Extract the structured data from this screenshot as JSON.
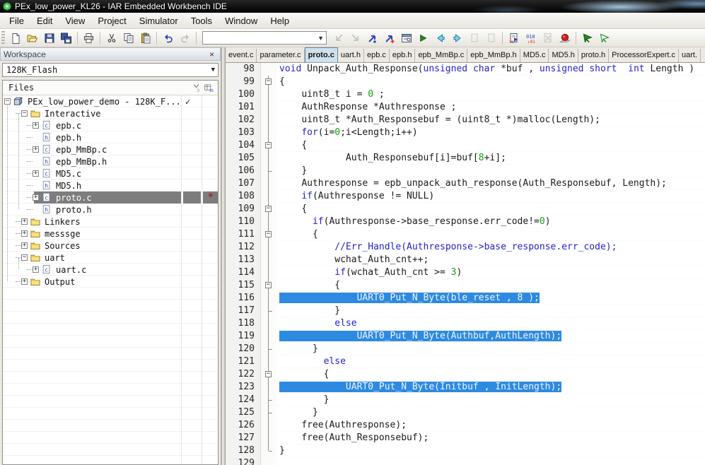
{
  "window": {
    "title": "PEx_low_power_KL26 - IAR Embedded Workbench IDE"
  },
  "menu": {
    "items": [
      "File",
      "Edit",
      "View",
      "Project",
      "Simulator",
      "Tools",
      "Window",
      "Help"
    ]
  },
  "toolbar": {
    "combo_value": "",
    "items": [
      {
        "t": "icon",
        "n": "new-file"
      },
      {
        "t": "icon",
        "n": "open-file"
      },
      {
        "t": "icon",
        "n": "save-file"
      },
      {
        "t": "icon",
        "n": "save-all"
      },
      {
        "t": "sep"
      },
      {
        "t": "icon",
        "n": "print"
      },
      {
        "t": "sep"
      },
      {
        "t": "icon",
        "n": "cut"
      },
      {
        "t": "icon",
        "n": "copy"
      },
      {
        "t": "icon",
        "n": "paste"
      },
      {
        "t": "sep"
      },
      {
        "t": "icon",
        "n": "undo"
      },
      {
        "t": "icon",
        "n": "redo",
        "d": 1
      },
      {
        "t": "sep"
      },
      {
        "t": "combo"
      },
      {
        "t": "icon",
        "n": "find-previous",
        "d": 1
      },
      {
        "t": "icon",
        "n": "find-next",
        "d": 1
      },
      {
        "t": "icon",
        "n": "toggle-bookmark"
      },
      {
        "t": "icon",
        "n": "add-bookmark"
      },
      {
        "t": "icon",
        "n": "find-in-files"
      },
      {
        "t": "icon",
        "n": "go"
      },
      {
        "t": "icon",
        "n": "navigate-back"
      },
      {
        "t": "icon",
        "n": "navigate-forward"
      },
      {
        "t": "icon",
        "n": "previous-bookmark",
        "d": 1
      },
      {
        "t": "icon",
        "n": "next-bookmark",
        "d": 1
      },
      {
        "t": "sep"
      },
      {
        "t": "icon",
        "n": "make"
      },
      {
        "t": "icon",
        "n": "compile"
      },
      {
        "t": "icon",
        "n": "stop-build",
        "d": 1
      },
      {
        "t": "icon",
        "n": "toggle-breakpoint"
      },
      {
        "t": "sep"
      },
      {
        "t": "icon",
        "n": "download-and-debug"
      },
      {
        "t": "icon",
        "n": "debug-without-downloading"
      }
    ]
  },
  "workspace": {
    "title": "Workspace",
    "close_glyph": "×",
    "config_select": "128K_Flash",
    "files_header": "Files",
    "check_glyph": "✓",
    "modified_glyph": "*",
    "tree": [
      {
        "label": "PEx_low_power_demo - 128K_F...",
        "level": 0,
        "exp": "minus",
        "icon": "project",
        "check": true
      },
      {
        "label": "Interactive",
        "level": 1,
        "exp": "minus",
        "icon": "folder"
      },
      {
        "label": "epb.c",
        "level": 2,
        "exp": "plus",
        "icon": "cfile"
      },
      {
        "label": "epb.h",
        "level": 2,
        "exp": "none",
        "icon": "hfile"
      },
      {
        "label": "epb_MmBp.c",
        "level": 2,
        "exp": "plus",
        "icon": "cfile"
      },
      {
        "label": "epb_MmBp.h",
        "level": 2,
        "exp": "none",
        "icon": "hfile"
      },
      {
        "label": "MD5.c",
        "level": 2,
        "exp": "plus",
        "icon": "cfile"
      },
      {
        "label": "MD5.h",
        "level": 2,
        "exp": "none",
        "icon": "hfile"
      },
      {
        "label": "proto.c",
        "level": 2,
        "exp": "plus",
        "icon": "cfile",
        "selected": true,
        "marker": true
      },
      {
        "label": "proto.h",
        "level": 2,
        "exp": "none",
        "icon": "hfile"
      },
      {
        "label": "Linkers",
        "level": 1,
        "exp": "plus",
        "icon": "folder"
      },
      {
        "label": "messsge",
        "level": 1,
        "exp": "plus",
        "icon": "folder"
      },
      {
        "label": "Sources",
        "level": 1,
        "exp": "plus",
        "icon": "folder"
      },
      {
        "label": "uart",
        "level": 1,
        "exp": "minus",
        "icon": "folder"
      },
      {
        "label": "uart.c",
        "level": 2,
        "exp": "plus",
        "icon": "cfile"
      },
      {
        "label": "Output",
        "level": 1,
        "exp": "plus",
        "icon": "folder"
      }
    ]
  },
  "editor": {
    "tabs": [
      {
        "label": "event.c"
      },
      {
        "label": "parameter.c"
      },
      {
        "label": "proto.c",
        "active": true
      },
      {
        "label": "uart.h"
      },
      {
        "label": "epb.c"
      },
      {
        "label": "epb.h"
      },
      {
        "label": "epb_MmBp.c"
      },
      {
        "label": "epb_MmBp.h"
      },
      {
        "label": "MD5.c"
      },
      {
        "label": "MD5.h"
      },
      {
        "label": "proto.h"
      },
      {
        "label": "ProcessorExpert.c"
      },
      {
        "label": "uart."
      }
    ],
    "lines": [
      {
        "num": 98,
        "fold": "none",
        "ind": 0,
        "segs": [
          [
            "void",
            "k"
          ],
          [
            " Unpack_Auth_Response(",
            "p"
          ],
          [
            "unsigned",
            "k"
          ],
          [
            " ",
            "p"
          ],
          [
            "char",
            "k"
          ],
          [
            " *buf , ",
            "p"
          ],
          [
            "unsigned",
            "k"
          ],
          [
            " ",
            "p"
          ],
          [
            "short",
            "k"
          ],
          [
            "  ",
            "p"
          ],
          [
            "int",
            "k"
          ],
          [
            " Length )",
            "p"
          ]
        ]
      },
      {
        "num": 99,
        "fold": "box",
        "ind": 0,
        "segs": [
          [
            "{",
            "p"
          ]
        ]
      },
      {
        "num": 100,
        "fold": "line",
        "ind": 4,
        "segs": [
          [
            "uint8_t i = ",
            "p"
          ],
          [
            "0",
            "n"
          ],
          [
            " ;",
            "p"
          ]
        ]
      },
      {
        "num": 101,
        "fold": "line",
        "ind": 4,
        "segs": [
          [
            "AuthResponse *Authresponse ;",
            "p"
          ]
        ]
      },
      {
        "num": 102,
        "fold": "line",
        "ind": 4,
        "segs": [
          [
            "uint8_t *Auth_Responsebuf = (uint8_t *)malloc(Length);",
            "p"
          ]
        ]
      },
      {
        "num": 103,
        "fold": "line",
        "ind": 4,
        "segs": [
          [
            "for",
            "k"
          ],
          [
            "(i=",
            "p"
          ],
          [
            "0",
            "n"
          ],
          [
            ";i<Length;i++)",
            "p"
          ]
        ]
      },
      {
        "num": 104,
        "fold": "box",
        "ind": 4,
        "segs": [
          [
            "{",
            "p"
          ]
        ]
      },
      {
        "num": 105,
        "fold": "line",
        "ind": 12,
        "segs": [
          [
            "Auth_Responsebuf[i]=buf[",
            "p"
          ],
          [
            "8",
            "n"
          ],
          [
            "+i];",
            "p"
          ]
        ]
      },
      {
        "num": 106,
        "fold": "tick",
        "ind": 4,
        "segs": [
          [
            "}",
            "p"
          ]
        ]
      },
      {
        "num": 107,
        "fold": "line",
        "ind": 4,
        "segs": [
          [
            "Authresponse = epb_unpack_auth_response(Auth_Responsebuf, Length);",
            "p"
          ]
        ]
      },
      {
        "num": 108,
        "fold": "line",
        "ind": 4,
        "segs": [
          [
            "if",
            "k"
          ],
          [
            "(Authresponse != NULL)",
            "p"
          ]
        ]
      },
      {
        "num": 109,
        "fold": "box",
        "ind": 4,
        "segs": [
          [
            "{",
            "p"
          ]
        ]
      },
      {
        "num": 110,
        "fold": "line",
        "ind": 6,
        "segs": [
          [
            "if",
            "k"
          ],
          [
            "(Authresponse->base_response.err_code!=",
            "p"
          ],
          [
            "0",
            "n"
          ],
          [
            ")",
            "p"
          ]
        ]
      },
      {
        "num": 111,
        "fold": "box",
        "ind": 6,
        "segs": [
          [
            "{",
            "p"
          ]
        ]
      },
      {
        "num": 112,
        "fold": "line",
        "ind": 10,
        "segs": [
          [
            "//Err_Handle(Authresponse->base_response.err_code);",
            "c"
          ]
        ]
      },
      {
        "num": 113,
        "fold": "line",
        "ind": 10,
        "segs": [
          [
            "wchat_Auth_cnt++;",
            "p"
          ]
        ]
      },
      {
        "num": 114,
        "fold": "line",
        "ind": 10,
        "segs": [
          [
            "if",
            "k"
          ],
          [
            "(wchat_Auth_cnt >= ",
            "p"
          ],
          [
            "3",
            "n"
          ],
          [
            ")",
            "p"
          ]
        ]
      },
      {
        "num": 115,
        "fold": "box",
        "ind": 10,
        "segs": [
          [
            "{",
            "p"
          ]
        ]
      },
      {
        "num": 116,
        "fold": "line",
        "ind": 14,
        "sel": true,
        "segs": [
          [
            "UART0_Put_N_Byte(ble_reset , 8 );",
            "w"
          ]
        ]
      },
      {
        "num": 117,
        "fold": "tick",
        "ind": 10,
        "segs": [
          [
            "}",
            "p"
          ]
        ]
      },
      {
        "num": 118,
        "fold": "line",
        "ind": 10,
        "segs": [
          [
            "else",
            "k"
          ]
        ]
      },
      {
        "num": 119,
        "fold": "line",
        "ind": 14,
        "sel": true,
        "segs": [
          [
            "UART0_Put_N_Byte(Authbuf,AuthLength);",
            "w"
          ]
        ]
      },
      {
        "num": 120,
        "fold": "tick",
        "ind": 6,
        "segs": [
          [
            "}",
            "p"
          ]
        ]
      },
      {
        "num": 121,
        "fold": "line",
        "ind": 8,
        "segs": [
          [
            "else",
            "k"
          ]
        ]
      },
      {
        "num": 122,
        "fold": "box",
        "ind": 8,
        "segs": [
          [
            "{",
            "p"
          ]
        ]
      },
      {
        "num": 123,
        "fold": "line",
        "ind": 12,
        "sel": true,
        "segs": [
          [
            "UART0_Put_N_Byte(Initbuf , InitLength);",
            "w"
          ]
        ]
      },
      {
        "num": 124,
        "fold": "tick",
        "ind": 8,
        "segs": [
          [
            "}",
            "p"
          ]
        ]
      },
      {
        "num": 125,
        "fold": "tick",
        "ind": 6,
        "segs": [
          [
            "}",
            "p"
          ]
        ]
      },
      {
        "num": 126,
        "fold": "line",
        "ind": 4,
        "segs": [
          [
            "free(Authresponse);",
            "p"
          ]
        ]
      },
      {
        "num": 127,
        "fold": "line",
        "ind": 4,
        "segs": [
          [
            "free(Auth_Responsebuf);",
            "p"
          ]
        ]
      },
      {
        "num": 128,
        "fold": "end",
        "ind": 0,
        "segs": [
          [
            "}",
            "p"
          ]
        ]
      },
      {
        "num": 129,
        "fold": "none",
        "ind": 0,
        "segs": []
      }
    ]
  },
  "colors": {
    "selection_blue": "#2e8ae0",
    "keyword_blue": "#2323c8",
    "number_green": "#13a013",
    "tree_selected_gray": "#7d7d7d",
    "breakpoint_red": "#d81f1f",
    "active_tab_blue": "#cfe1ef"
  }
}
